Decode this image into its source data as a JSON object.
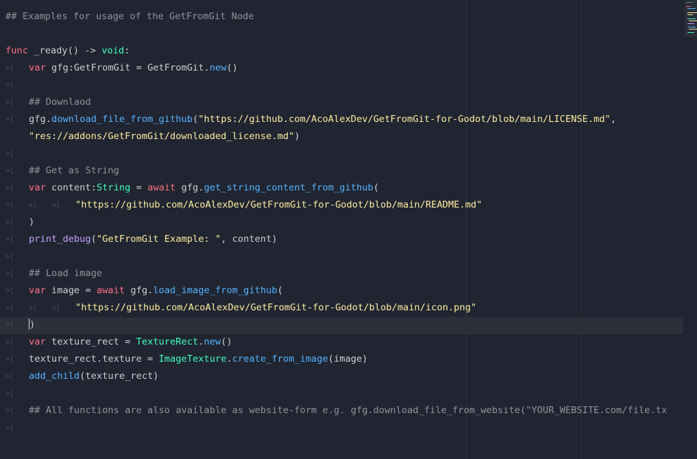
{
  "editor": {
    "lines": [
      {
        "indent": 0,
        "tabs": [],
        "tokens": [
          {
            "t": "comment",
            "v": "## Examples for usage of the GetFromGit Node"
          }
        ]
      },
      {
        "indent": 0,
        "tabs": [],
        "tokens": []
      },
      {
        "indent": 0,
        "tabs": [],
        "tokens": [
          {
            "t": "kw",
            "v": "func"
          },
          {
            "t": "plain",
            "v": " _ready() -> "
          },
          {
            "t": "ty",
            "v": "void"
          },
          {
            "t": "plain",
            "v": ":"
          }
        ]
      },
      {
        "indent": 1,
        "tabs": [
          ">|"
        ],
        "tokens": [
          {
            "t": "kw",
            "v": "var"
          },
          {
            "t": "plain",
            "v": " gfg:GetFromGit = GetFromGit."
          },
          {
            "t": "fn",
            "v": "new"
          },
          {
            "t": "plain",
            "v": "()"
          }
        ]
      },
      {
        "indent": 1,
        "tabs": [
          ">|"
        ],
        "tokens": []
      },
      {
        "indent": 1,
        "tabs": [
          ">|"
        ],
        "tokens": [
          {
            "t": "comment",
            "v": "## Downlaod"
          }
        ]
      },
      {
        "indent": 1,
        "tabs": [
          ">|"
        ],
        "tokens": [
          {
            "t": "plain",
            "v": "gfg."
          },
          {
            "t": "fn",
            "v": "download_file_from_github"
          },
          {
            "t": "plain",
            "v": "("
          },
          {
            "t": "str",
            "v": "\"https://github.com/AcoAlexDev/GetFromGit-for-Godot/blob/main/LICENSE.md\""
          },
          {
            "t": "plain",
            "v": ","
          }
        ]
      },
      {
        "indent": 1,
        "tabs": [],
        "tokens": [
          {
            "t": "str",
            "v": "\"res://addons/GetFromGit/downloaded_license.md\""
          },
          {
            "t": "plain",
            "v": ")"
          }
        ]
      },
      {
        "indent": 1,
        "tabs": [
          ">|"
        ],
        "tokens": []
      },
      {
        "indent": 1,
        "tabs": [
          ">|"
        ],
        "tokens": [
          {
            "t": "comment",
            "v": "## Get as String"
          }
        ]
      },
      {
        "indent": 1,
        "tabs": [
          ">|"
        ],
        "tokens": [
          {
            "t": "kw",
            "v": "var"
          },
          {
            "t": "plain",
            "v": " content:"
          },
          {
            "t": "ty",
            "v": "String"
          },
          {
            "t": "plain",
            "v": " = "
          },
          {
            "t": "kw",
            "v": "await"
          },
          {
            "t": "plain",
            "v": " gfg."
          },
          {
            "t": "fn",
            "v": "get_string_content_from_github"
          },
          {
            "t": "plain",
            "v": "("
          }
        ]
      },
      {
        "indent": 3,
        "tabs": [
          ">|",
          ">|",
          ">|"
        ],
        "tokens": [
          {
            "t": "str",
            "v": "\"https://github.com/AcoAlexDev/GetFromGit-for-Godot/blob/main/README.md\""
          }
        ]
      },
      {
        "indent": 1,
        "tabs": [
          ">|"
        ],
        "tokens": [
          {
            "t": "plain",
            "v": ")"
          }
        ]
      },
      {
        "indent": 1,
        "tabs": [
          ">|"
        ],
        "tokens": [
          {
            "t": "bfn",
            "v": "print_debug"
          },
          {
            "t": "plain",
            "v": "("
          },
          {
            "t": "str",
            "v": "\"GetFromGit Example: \""
          },
          {
            "t": "plain",
            "v": ", content)"
          }
        ]
      },
      {
        "indent": 1,
        "tabs": [
          ">|"
        ],
        "tokens": []
      },
      {
        "indent": 1,
        "tabs": [
          ">|"
        ],
        "tokens": [
          {
            "t": "comment",
            "v": "## Load image"
          }
        ]
      },
      {
        "indent": 1,
        "tabs": [
          ">|"
        ],
        "tokens": [
          {
            "t": "kw",
            "v": "var"
          },
          {
            "t": "plain",
            "v": " image = "
          },
          {
            "t": "kw",
            "v": "await"
          },
          {
            "t": "plain",
            "v": " gfg."
          },
          {
            "t": "fn",
            "v": "load_image_from_github"
          },
          {
            "t": "plain",
            "v": "("
          }
        ]
      },
      {
        "indent": 3,
        "tabs": [
          ">|",
          ">|",
          ">|"
        ],
        "tokens": [
          {
            "t": "str",
            "v": "\"https://github.com/AcoAlexDev/GetFromGit-for-Godot/blob/main/icon.png\""
          }
        ]
      },
      {
        "indent": 1,
        "tabs": [
          ">|"
        ],
        "tokens": [
          {
            "t": "plain",
            "v": ")"
          }
        ],
        "caret": true
      },
      {
        "indent": 1,
        "tabs": [
          ">|"
        ],
        "tokens": [
          {
            "t": "kw",
            "v": "var"
          },
          {
            "t": "plain",
            "v": " texture_rect = "
          },
          {
            "t": "ty",
            "v": "TextureRect"
          },
          {
            "t": "plain",
            "v": "."
          },
          {
            "t": "fn",
            "v": "new"
          },
          {
            "t": "plain",
            "v": "()"
          }
        ]
      },
      {
        "indent": 1,
        "tabs": [
          ">|"
        ],
        "tokens": [
          {
            "t": "plain",
            "v": "texture_rect.texture = "
          },
          {
            "t": "ty",
            "v": "ImageTexture"
          },
          {
            "t": "plain",
            "v": "."
          },
          {
            "t": "fn",
            "v": "create_from_image"
          },
          {
            "t": "plain",
            "v": "(image)"
          }
        ]
      },
      {
        "indent": 1,
        "tabs": [
          ">|"
        ],
        "tokens": [
          {
            "t": "fn",
            "v": "add_child"
          },
          {
            "t": "plain",
            "v": "(texture_rect)"
          }
        ]
      },
      {
        "indent": 1,
        "tabs": [
          ">|"
        ],
        "tokens": []
      },
      {
        "indent": 1,
        "tabs": [
          ">|"
        ],
        "tokens": [
          {
            "t": "comment",
            "v": "## All functions are also available as website-form e.g. gfg.download_file_from_website(\"YOUR_WEBSITE.com/file.tx"
          }
        ]
      },
      {
        "indent": 1,
        "tabs": [
          ">|"
        ],
        "tokens": []
      }
    ]
  },
  "colors": {
    "background": "#202531",
    "comment": "#8f949c",
    "keyword": "#ff7085",
    "type": "#42ffc2",
    "function": "#57b3ff",
    "builtin_function": "#c7a2ff",
    "string": "#ffeda1",
    "text": "#cdcfd2"
  }
}
